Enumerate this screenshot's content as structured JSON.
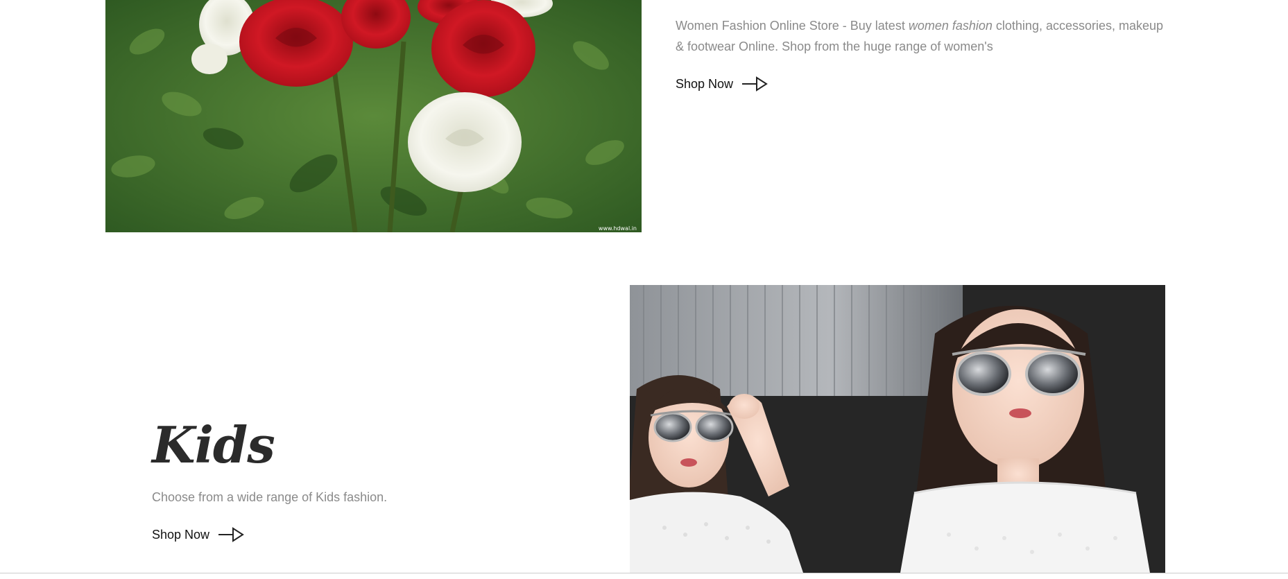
{
  "women": {
    "description_start": "Women Fashion  Online Store - Buy latest ",
    "description_emphasis": "women fashion",
    "description_end": " clothing, accessories, makeup & footwear Online. Shop from the huge range of women's",
    "shop_now_label": "Shop Now",
    "image_subject": "red and white roses photo",
    "image_watermark": "www.hdwal.in"
  },
  "kids": {
    "title": "Kids",
    "description": "Choose from a wide range of Kids fashion.",
    "shop_now_label": "Shop Now",
    "image_subject": "two girls in white dresses wearing sunglasses photo"
  },
  "icons": {
    "shop_arrow": "arrow-right-icon"
  },
  "colors": {
    "text_muted": "#8a8a8a",
    "text_dark": "#111111",
    "title": "#2b2b2b"
  }
}
